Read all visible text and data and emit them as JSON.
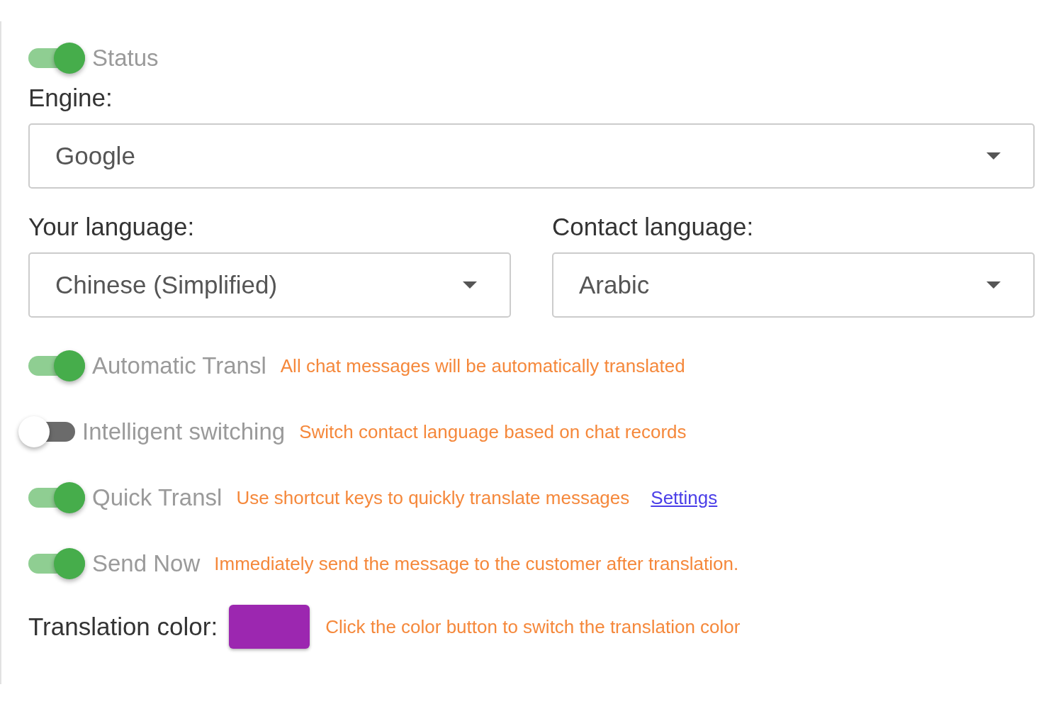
{
  "status": {
    "label": "Status",
    "on": true
  },
  "engine": {
    "label": "Engine:",
    "value": "Google"
  },
  "languages": [
    {
      "label": "Your language:",
      "value": "Chinese (Simplified)"
    },
    {
      "label": "Contact language:",
      "value": "Arabic"
    }
  ],
  "options": [
    {
      "label": "Automatic Transl",
      "on": true,
      "hint": "All chat messages will be automatically translated"
    },
    {
      "label": "Intelligent switching",
      "on": false,
      "hint": "Switch contact language based on chat records"
    },
    {
      "label": "Quick Transl",
      "on": true,
      "hint": "Use shortcut keys to quickly translate messages",
      "link": "Settings"
    },
    {
      "label": "Send Now",
      "on": true,
      "hint": "Immediately send the message to the customer after translation."
    }
  ],
  "translation_color": {
    "label": "Translation color:",
    "color": "#9c27b0",
    "hint": "Click the color button to switch the translation color"
  }
}
